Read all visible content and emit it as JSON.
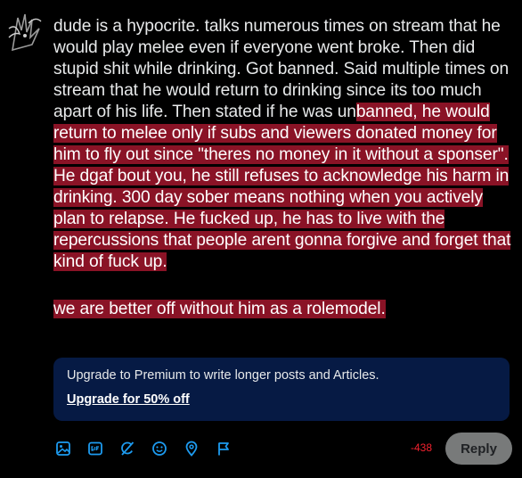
{
  "post": {
    "p1_plain": "dude is a hypocrite. talks numerous times on stream that he would play melee even if everyone went broke. Then did stupid shit while drinking. Got banned. Said multiple times on stream that he would return to drinking since its too much apart of his life. Then stated if he was un",
    "p1_highlight": "banned, he would return to melee only if subs and viewers donated money for him to fly out since \"theres no money in it without a sponser\". He dgaf bout you, he still refuses to acknowledge his harm in drinking. 300 day sober means nothing when you actively plan to relapse. He fucked up, he has to live with the repercussions that people arent gonna forgive and forget that kind of fuck up.",
    "p2_highlight": "we are better off without him as a rolemodel."
  },
  "premium": {
    "message": "Upgrade to Premium to write longer posts and Articles.",
    "cta": "Upgrade for 50% off"
  },
  "toolbar": {
    "icons": [
      "image-icon",
      "gif-icon",
      "grok-icon",
      "emoji-icon",
      "location-icon",
      "flag-icon"
    ]
  },
  "char_count": "-438",
  "reply_label": "Reply",
  "colors": {
    "highlight": "#8a1326",
    "accent": "#1d9bf0",
    "over_limit": "#f4212e",
    "premium_bg": "#061a44",
    "reply_bg": "#787a7a"
  }
}
